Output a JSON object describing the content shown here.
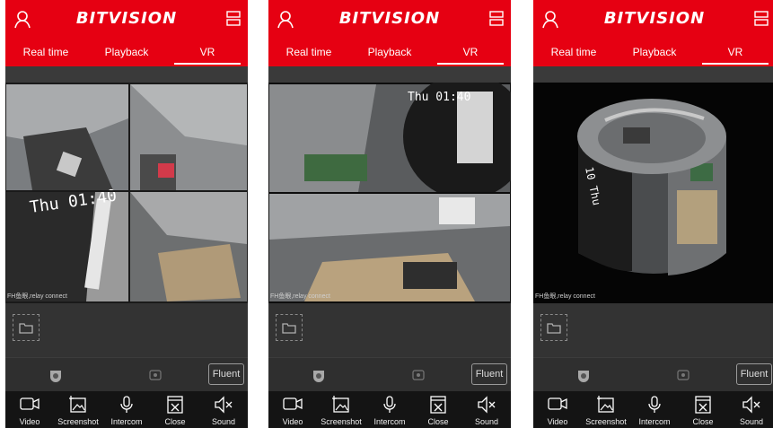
{
  "screens": [
    {
      "app": {
        "brand": "BITVISION"
      },
      "tabs": [
        "Real time",
        "Playback",
        "VR"
      ],
      "active_tab": "VR",
      "video": {
        "status_text": "FH鱼眼,relay connect"
      },
      "quality_label": "Fluent",
      "toolbar": [
        {
          "label": "Video",
          "icon": "video-icon"
        },
        {
          "label": "Screenshot",
          "icon": "screenshot-icon"
        },
        {
          "label": "Intercom",
          "icon": "microphone-icon"
        },
        {
          "label": "Close",
          "icon": "close-icon"
        },
        {
          "label": "Sound",
          "icon": "speaker-mute-icon"
        }
      ]
    },
    {
      "app": {
        "brand": "BITVISION"
      },
      "tabs": [
        "Real time",
        "Playback",
        "VR"
      ],
      "active_tab": "VR",
      "video": {
        "status_text": "FH鱼眼,relay connect"
      },
      "quality_label": "Fluent",
      "toolbar": [
        {
          "label": "Video",
          "icon": "video-icon"
        },
        {
          "label": "Screenshot",
          "icon": "screenshot-icon"
        },
        {
          "label": "Intercom",
          "icon": "microphone-icon"
        },
        {
          "label": "Close",
          "icon": "close-icon"
        },
        {
          "label": "Sound",
          "icon": "speaker-mute-icon"
        }
      ]
    },
    {
      "app": {
        "brand": "BITVISION"
      },
      "tabs": [
        "Real time",
        "Playback",
        "VR"
      ],
      "active_tab": "VR",
      "video": {
        "status_text": "FH鱼眼,relay connect"
      },
      "quality_label": "Fluent",
      "toolbar": [
        {
          "label": "Video",
          "icon": "video-icon"
        },
        {
          "label": "Screenshot",
          "icon": "screenshot-icon"
        },
        {
          "label": "Intercom",
          "icon": "microphone-icon"
        },
        {
          "label": "Close",
          "icon": "close-icon"
        },
        {
          "label": "Sound",
          "icon": "speaker-mute-icon"
        }
      ]
    }
  ],
  "colors": {
    "header": "#e60012",
    "dark_bg": "#2b2b2b",
    "bottom_bar": "#141414"
  }
}
